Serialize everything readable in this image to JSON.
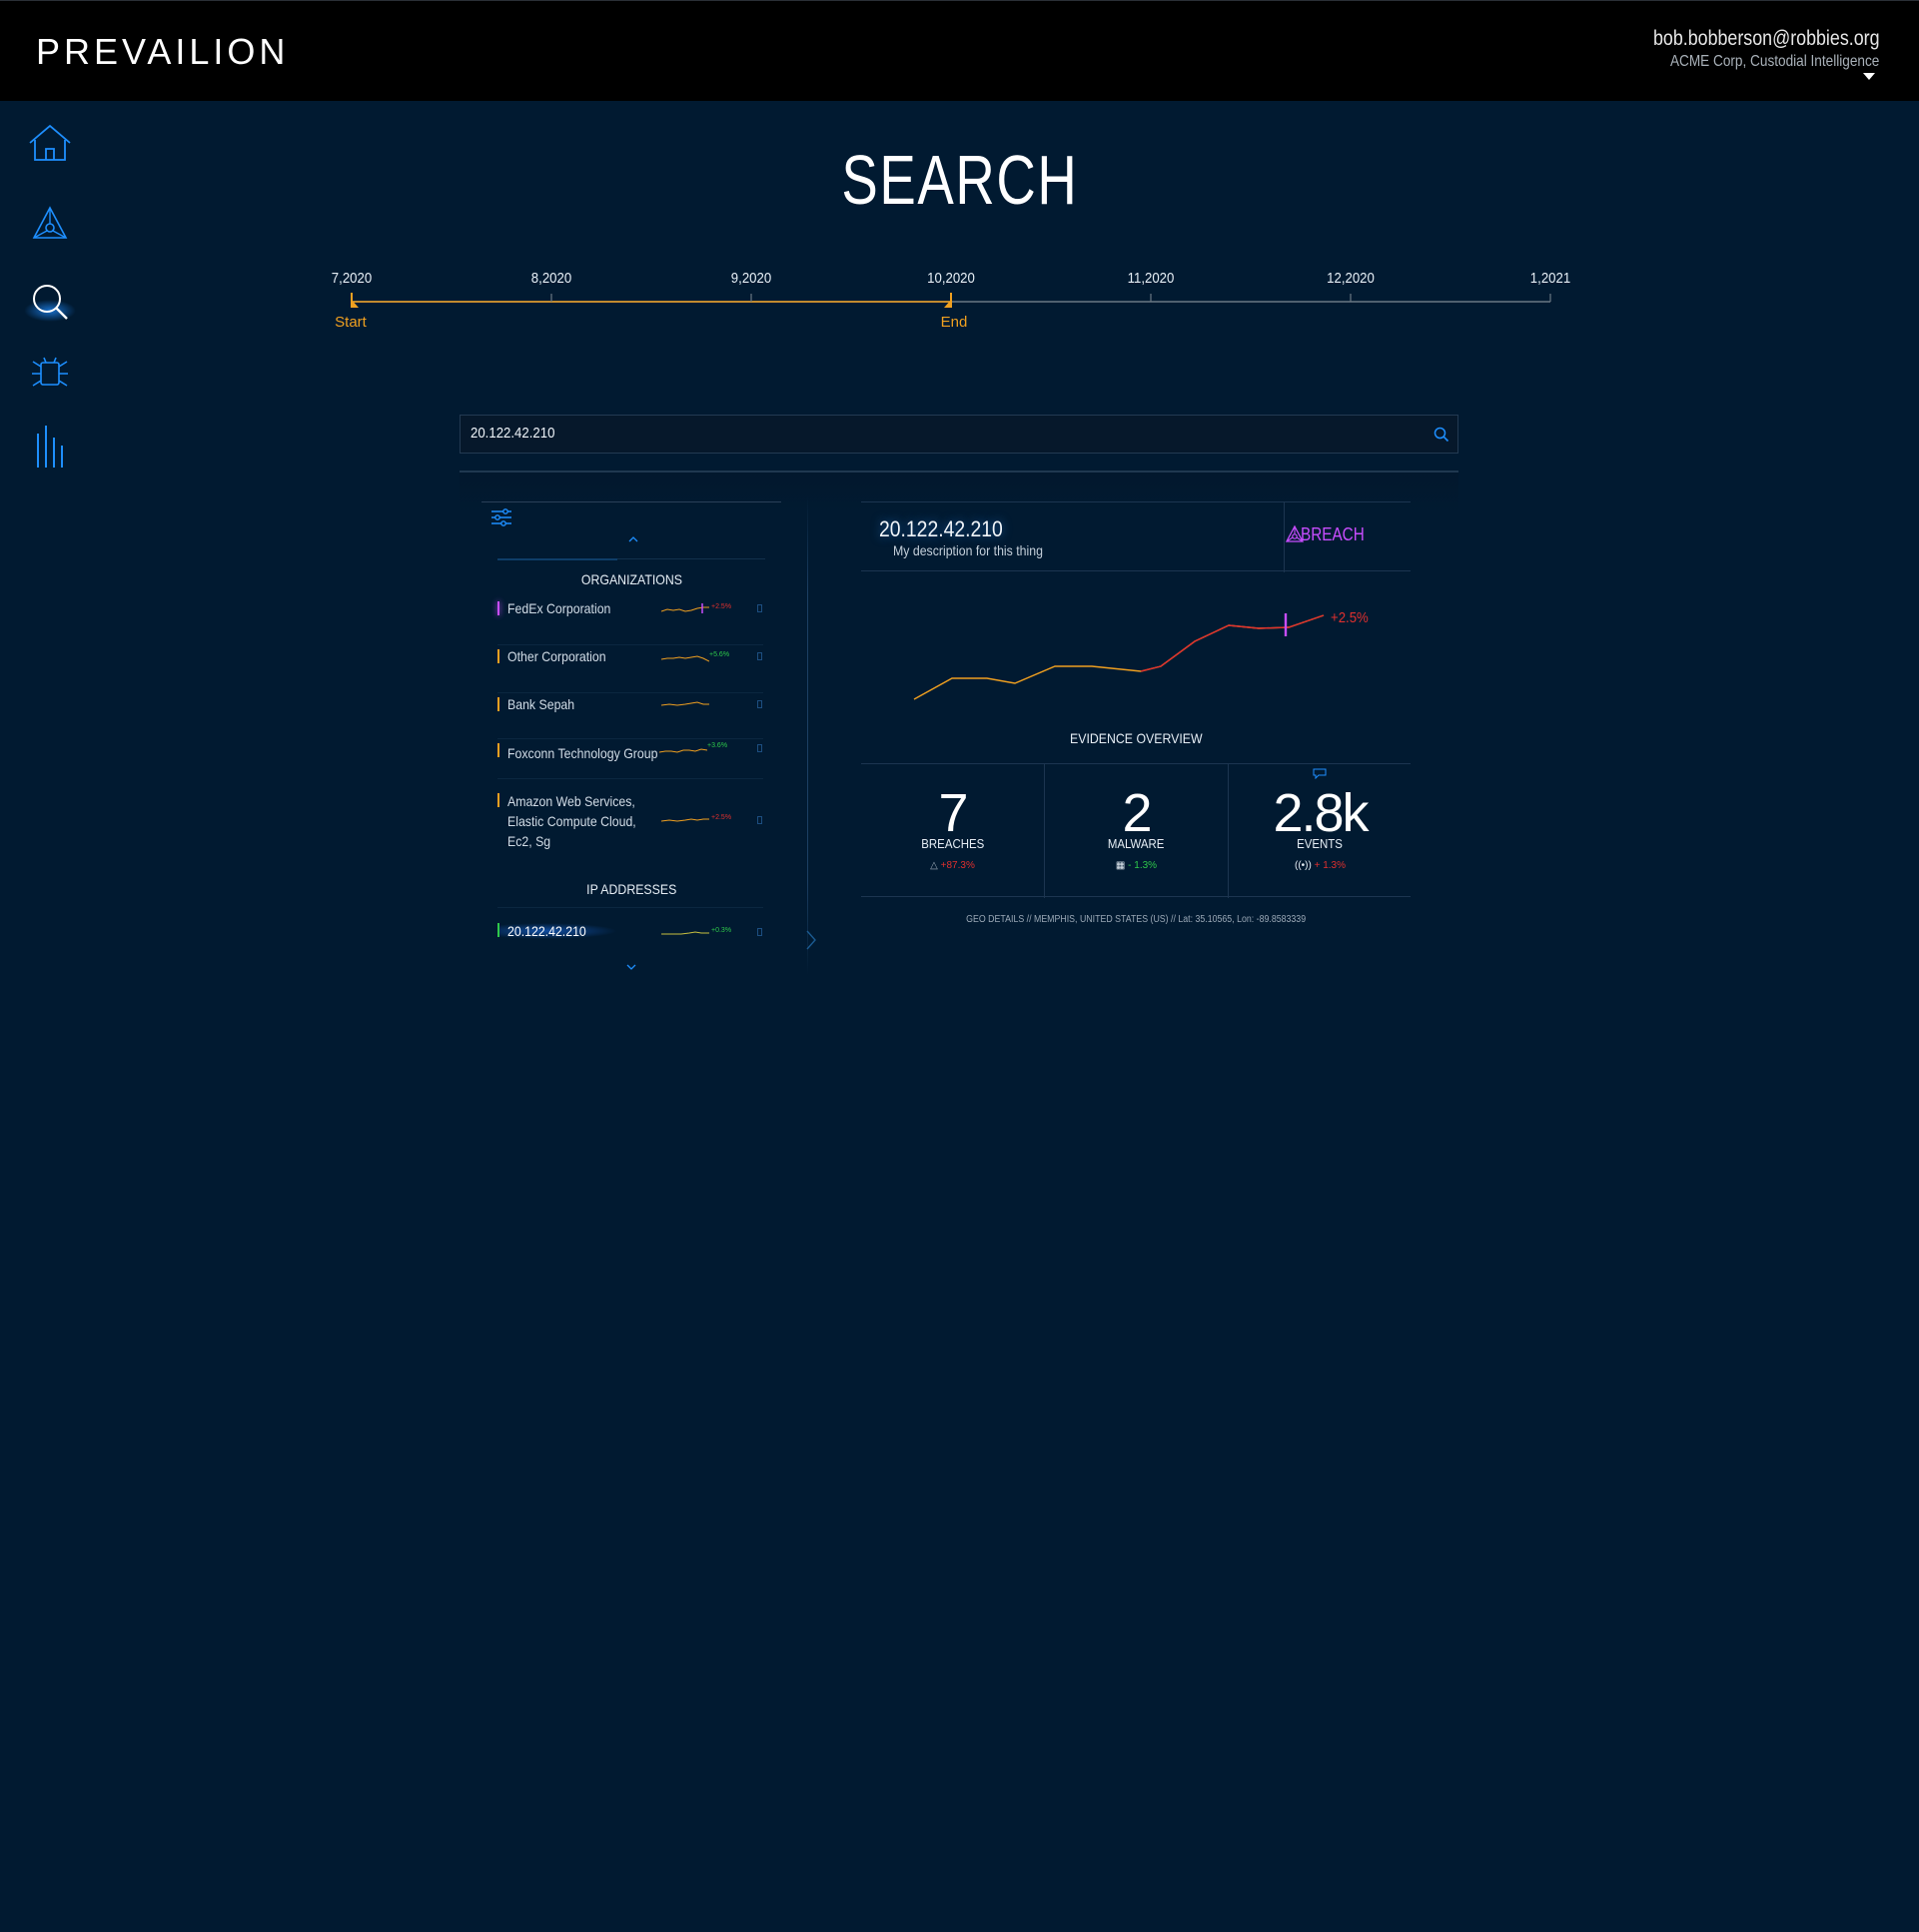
{
  "header": {
    "logo": "PREVAILION",
    "user_email": "bob.bobberson@robbies.org",
    "user_org": "ACME Corp, Custodial Intelligence"
  },
  "sidebar": {
    "items": [
      {
        "name": "home",
        "icon": "home-icon"
      },
      {
        "name": "network",
        "icon": "triangle-network-icon"
      },
      {
        "name": "search",
        "icon": "search-icon",
        "active": true
      },
      {
        "name": "bug",
        "icon": "bug-icon"
      },
      {
        "name": "analytics",
        "icon": "bars-icon"
      }
    ]
  },
  "page": {
    "title": "SEARCH"
  },
  "timeline": {
    "labels": [
      "7,2020",
      "8,2020",
      "9,2020",
      "10,2020",
      "11,2020",
      "12,2020",
      "1,2021"
    ],
    "start_label": "Start",
    "end_label": "End",
    "start_value": "7,2020",
    "end_value": "10,2020"
  },
  "search": {
    "value": "20.122.42.210"
  },
  "results": {
    "organizations_title": "ORGANIZATIONS",
    "ip_title": "IP ADDRESSES",
    "organizations": [
      {
        "label": "FedEx Corporation",
        "pct": "+2.5%"
      },
      {
        "label": "Other Corporation",
        "pct": "+5.6%"
      },
      {
        "label": "Bank Sepah",
        "pct": ""
      },
      {
        "label": "Foxconn Technology Group",
        "pct": "+3.6%"
      },
      {
        "label_lines": [
          "Amazon Web Services,",
          "Elastic Compute Cloud,",
          "Ec2, Sg"
        ],
        "pct": "+2.5%"
      }
    ],
    "ips": [
      {
        "label": "20.122.42.210",
        "pct": "+0.3%"
      }
    ]
  },
  "detail": {
    "ip": "20.122.42.210",
    "description": "My description for this thing",
    "tag": "BREACH",
    "trend_pct": "+2.5%",
    "evidence_title": "EVIDENCE OVERVIEW",
    "evidence": [
      {
        "value": "7",
        "label": "BREACHES",
        "delta": "+87.3%",
        "color": "#e0302e"
      },
      {
        "value": "2",
        "label": "MALWARE",
        "delta": "- 1.3%",
        "color": "#2ec84a"
      },
      {
        "value": "2.8k",
        "label": "EVENTS",
        "delta": "+ 1.3%",
        "color": "#e0302e"
      }
    ],
    "geo": "GEO DETAILS  //  MEMPHIS, UNITED STATES (US)  //  Lat: 35.10565, Lon: -89.8583339"
  },
  "colors": {
    "background": "#011a31",
    "accent_orange": "#f0a020",
    "accent_blue": "#1e8fff",
    "breach_purple": "#c84dff",
    "down_red": "#e0302e",
    "up_green": "#2ec84a"
  }
}
